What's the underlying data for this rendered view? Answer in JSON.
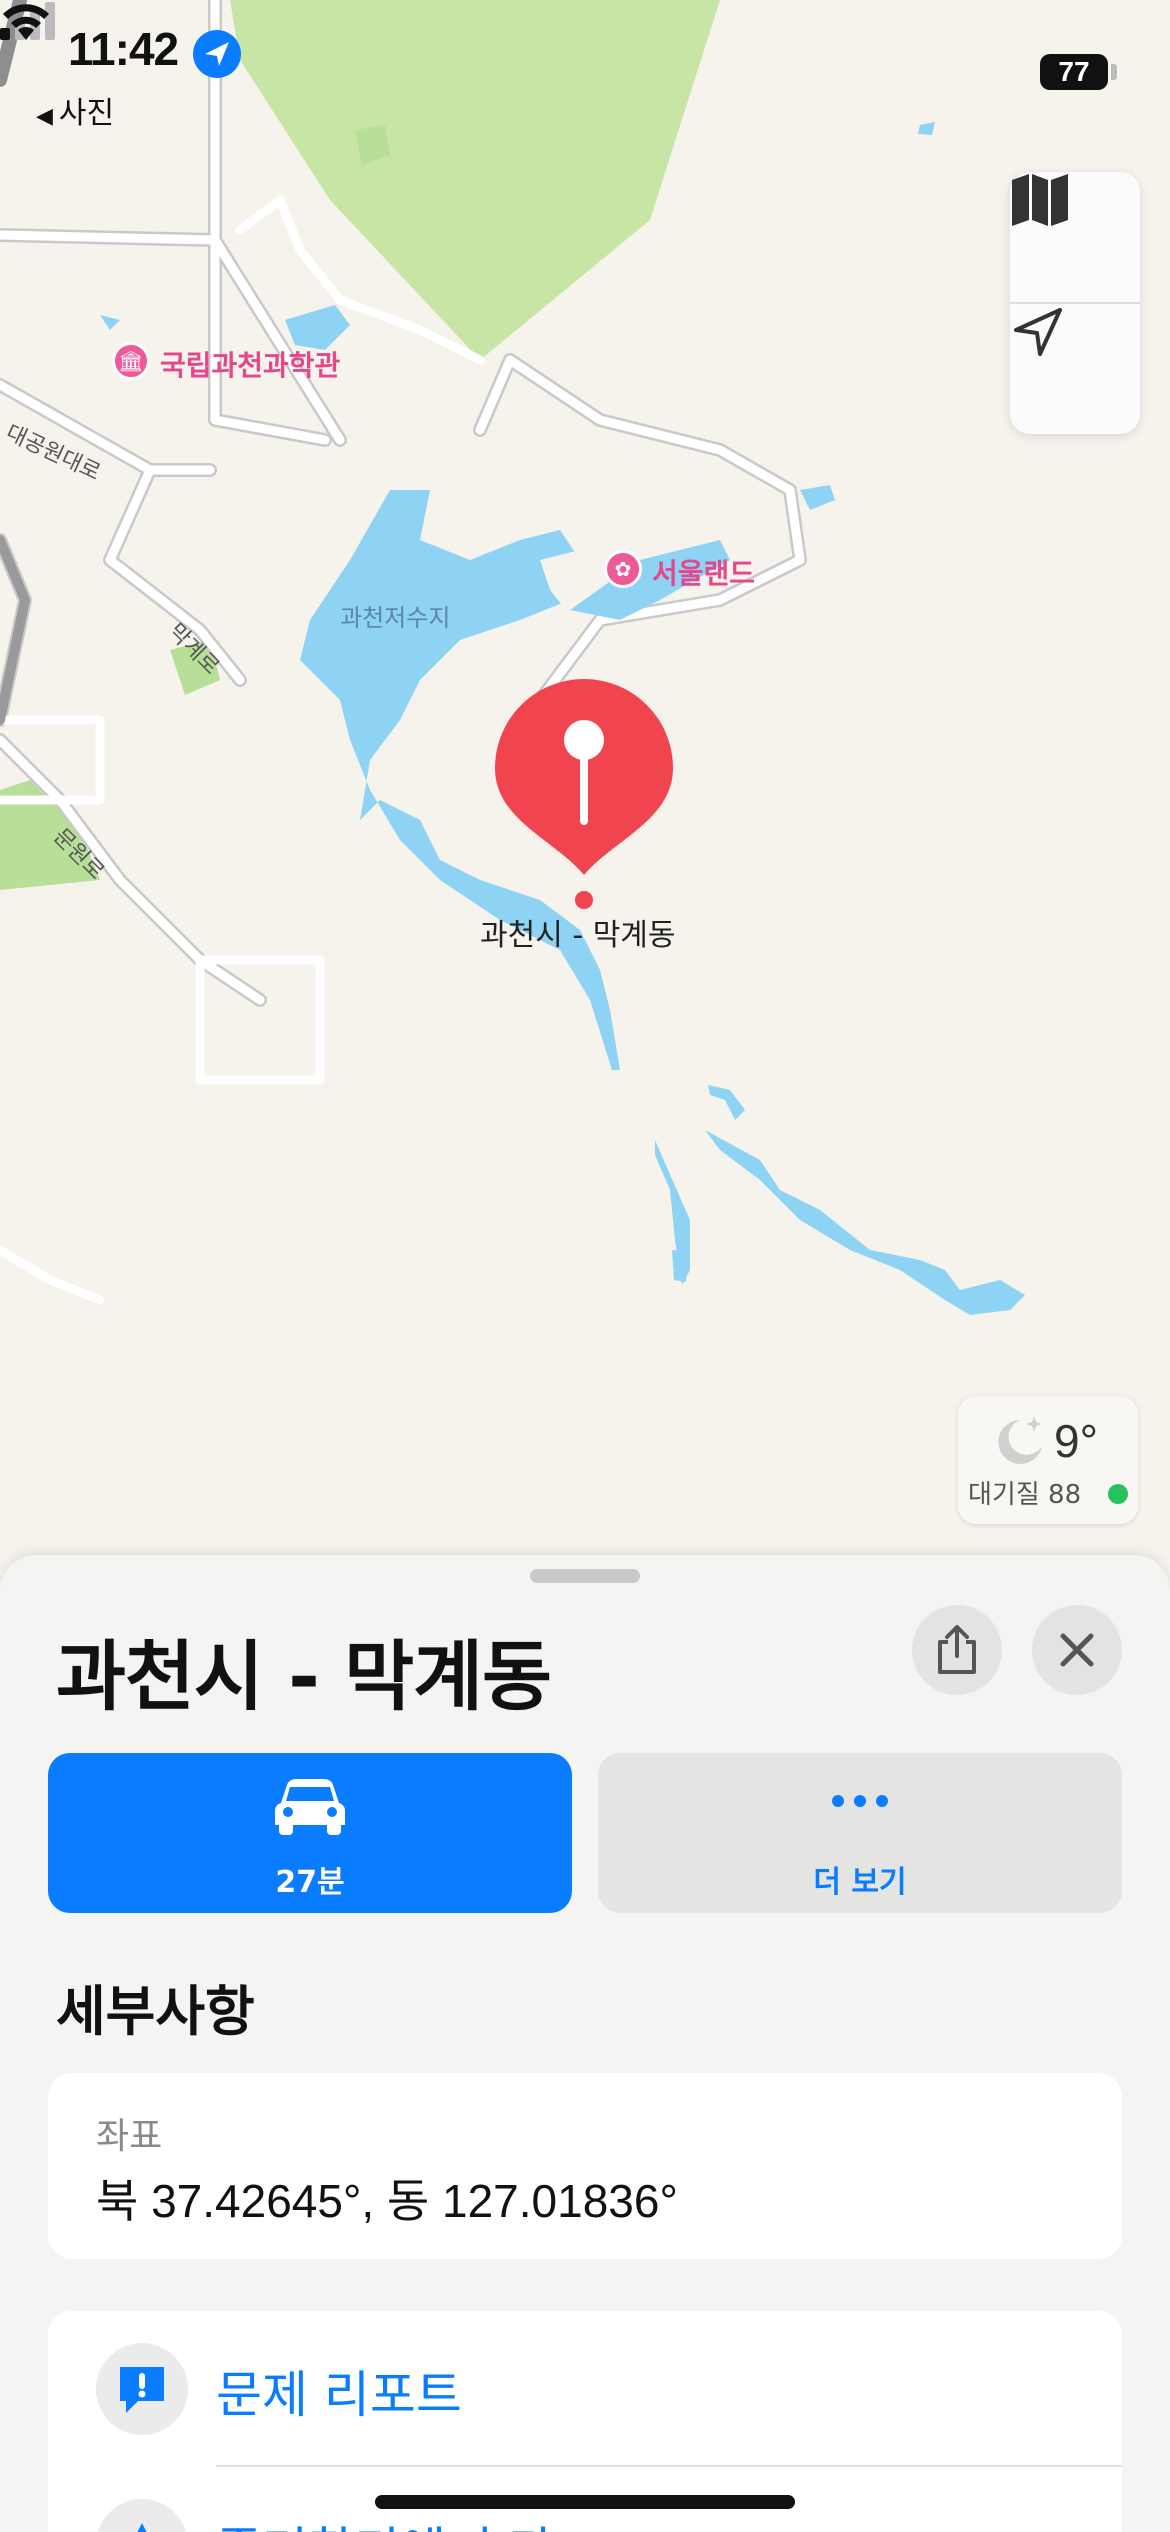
{
  "status_bar": {
    "time": "11:42",
    "back_label": "사진",
    "battery": "77",
    "location_icon": "location-arrow-icon",
    "signal_icon": "cellular-signal-icon",
    "wifi_icon": "wifi-icon"
  },
  "map": {
    "poi_labels": {
      "science_museum": "국립과천과학관",
      "seoul_land": "서울랜드"
    },
    "water_label": "과천저수지",
    "road_labels": {
      "daegongwon": "대공원대로",
      "makgye": "막계로",
      "munwon": "문원로"
    },
    "pin_label": "과천시 - 막계동",
    "controls": {
      "map_mode_icon": "map-icon",
      "locate_icon": "location-arrow-outline-icon"
    },
    "weather": {
      "temperature": "9°",
      "air_quality": "대기질 88",
      "icon": "moon-stars-icon"
    }
  },
  "sheet": {
    "title": "과천시 - 막계동",
    "share_icon": "share-icon",
    "close_icon": "close-icon",
    "directions": {
      "label": "27분",
      "icon": "car-icon"
    },
    "more": {
      "label": "더 보기",
      "icon": "ellipsis-icon"
    },
    "details_title": "세부사항",
    "coordinates": {
      "label": "좌표",
      "value": "북 37.42645°, 동 127.01836°"
    },
    "actions": [
      {
        "label": "문제 리포트",
        "icon": "report-icon"
      },
      {
        "label": "즐겨찾기에 추가",
        "icon": "favorite-icon"
      }
    ]
  },
  "colors": {
    "accent": "#0a7cff",
    "pin": "#f0454f",
    "water": "#8fd3f4",
    "park": "#c9e6a6",
    "poi": "#e4478b"
  }
}
